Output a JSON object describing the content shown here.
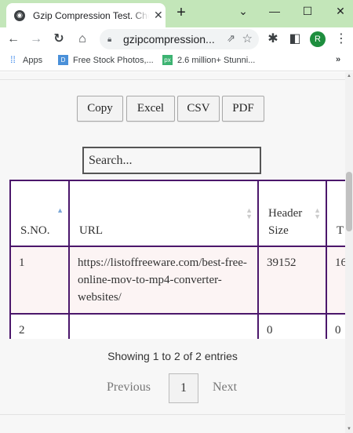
{
  "browser": {
    "tab_title": "Gzip Compression Test. Check",
    "tab_close": "✕",
    "new_tab": "+",
    "window_controls": {
      "chevron": "⌄",
      "minimize": "—",
      "maximize": "☐",
      "close": "✕"
    },
    "address": "gzipcompression...",
    "profile_initial": "R",
    "bookmarks": [
      {
        "label": "Apps",
        "icon": "apps-grid-icon",
        "color": "#1a73e8"
      },
      {
        "label": "Free Stock Photos,...",
        "icon": "bookmark-d-icon",
        "color": "#4a90d9"
      },
      {
        "label": "2.6 million+ Stunni...",
        "icon": "px-icon",
        "color": "#3cb371"
      }
    ],
    "bookmarks_more": "»",
    "accent_tab_strip": "#c3e6b9"
  },
  "page": {
    "export_buttons": [
      "Copy",
      "Excel",
      "CSV",
      "PDF"
    ],
    "search_placeholder": "Search...",
    "table": {
      "headers": [
        "S.NO.",
        "URL",
        "Header Size",
        "T S"
      ],
      "rows": [
        [
          "1",
          "https://listoffreeware.com/best-free-online-mov-to-mp4-converter-websites/",
          "39152",
          "16"
        ],
        [
          "2",
          "",
          "0",
          "0"
        ]
      ]
    },
    "info_text": "Showing 1 to 2 of 2 entries",
    "pagination": {
      "previous": "Previous",
      "current": "1",
      "next": "Next"
    },
    "border_color": "#4b176b",
    "odd_row_bg": "#fcf4f4"
  }
}
